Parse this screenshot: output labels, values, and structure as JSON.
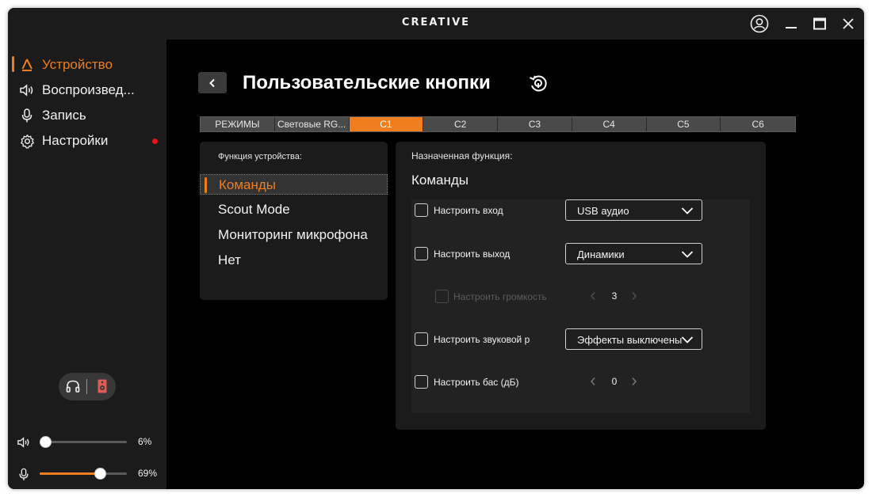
{
  "app": {
    "brand": "CREATIVE"
  },
  "sidebar": {
    "items": [
      {
        "label": "Устройство",
        "icon": "device-icon",
        "active": true
      },
      {
        "label": "Воспроизвед...",
        "icon": "speaker-icon",
        "active": false
      },
      {
        "label": "Запись",
        "icon": "microphone-icon",
        "active": false
      },
      {
        "label": "Настройки",
        "icon": "gear-icon",
        "active": false,
        "notification": true
      }
    ],
    "output_toggle": {
      "options": [
        "headphones-icon",
        "speaker-box-icon"
      ],
      "selected": "speaker-box-icon"
    },
    "playback_volume": {
      "value": 6,
      "label": "6%"
    },
    "mic_volume": {
      "value": 69,
      "label": "69%"
    }
  },
  "main": {
    "title": "Пользовательские кнопки",
    "tabs": [
      {
        "label": "РЕЖИМЫ",
        "active": false
      },
      {
        "label": "Световые RG...",
        "active": false
      },
      {
        "label": "C1",
        "active": true
      },
      {
        "label": "C2",
        "active": false
      },
      {
        "label": "C3",
        "active": false
      },
      {
        "label": "C4",
        "active": false
      },
      {
        "label": "C5",
        "active": false
      },
      {
        "label": "C6",
        "active": false
      }
    ],
    "device_function": {
      "label": "Функция устройства:",
      "items": [
        {
          "label": "Команды",
          "selected": true
        },
        {
          "label": "Scout Mode",
          "selected": false
        },
        {
          "label": "Мониторинг микрофона",
          "selected": false
        },
        {
          "label": "Нет",
          "selected": false
        }
      ]
    },
    "assigned": {
      "label": "Назначенная функция:",
      "value": "Команды",
      "rows": [
        {
          "label": "Настроить вход",
          "checked": false,
          "dropdown": "USB аудио"
        },
        {
          "label": "Настроить выход",
          "checked": false,
          "dropdown": "Динамики"
        },
        {
          "label": "Настроить громкость",
          "checked": false,
          "disabled": true,
          "stepper": "3"
        },
        {
          "label": "Настроить звуковой р",
          "checked": false,
          "dropdown": "Эффекты выключены"
        },
        {
          "label": "Настроить бас (дБ)",
          "checked": false,
          "stepper": "0"
        }
      ]
    }
  },
  "colors": {
    "accent": "#f07d1e",
    "panel": "#1b1b1b",
    "background": "#000000",
    "notification": "#e8141c"
  }
}
